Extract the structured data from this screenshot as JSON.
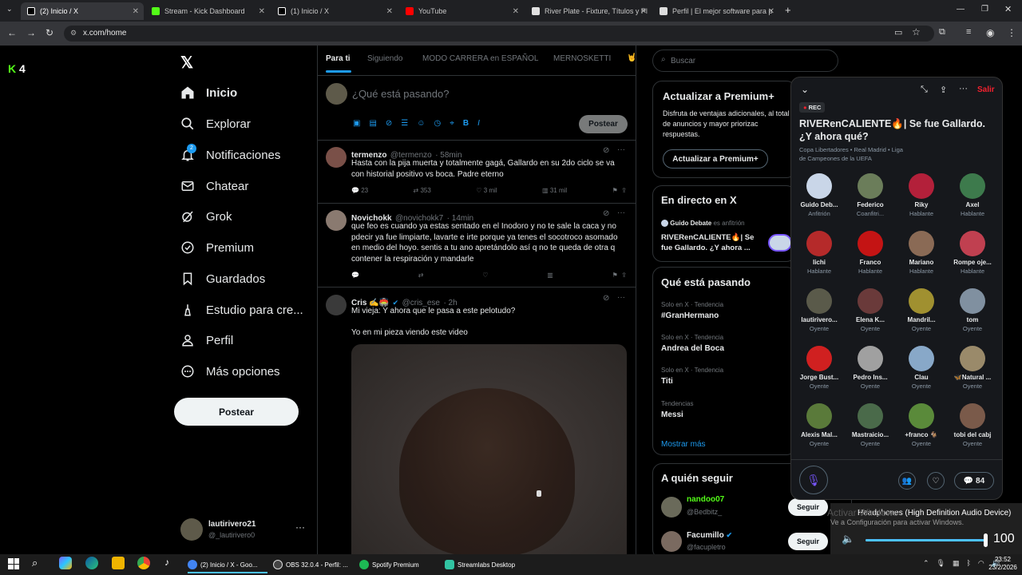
{
  "browser": {
    "tabs": [
      {
        "label": "(2) Inicio / X",
        "active": true
      },
      {
        "label": "Stream - Kick Dashboard"
      },
      {
        "label": "(1) Inicio / X"
      },
      {
        "label": "YouTube"
      },
      {
        "label": "River Plate - Fixture, Títulos y Pl"
      },
      {
        "label": "Perfil | El mejor software para p"
      }
    ],
    "url": "x.com/home"
  },
  "kick": {
    "count": "4"
  },
  "sidebar": {
    "items": [
      {
        "label": "Inicio",
        "icon": "home-icon"
      },
      {
        "label": "Explorar",
        "icon": "search-icon"
      },
      {
        "label": "Notificaciones",
        "icon": "bell-icon",
        "badge": "2"
      },
      {
        "label": "Chatear",
        "icon": "mail-icon"
      },
      {
        "label": "Grok",
        "icon": "grok-icon"
      },
      {
        "label": "Premium",
        "icon": "premium-icon"
      },
      {
        "label": "Guardados",
        "icon": "bookmark-icon"
      },
      {
        "label": "Estudio para cre...",
        "icon": "studio-icon"
      },
      {
        "label": "Perfil",
        "icon": "person-icon"
      },
      {
        "label": "Más opciones",
        "icon": "more-icon"
      }
    ],
    "post_button": "Postear",
    "account": {
      "name": "lautirivero21",
      "handle": "@_lautirivero0"
    }
  },
  "feed": {
    "tabs": [
      "Para ti",
      "Siguiendo",
      "MODO CARRERA en ESPAÑOL",
      "MERNOSKETTI"
    ],
    "composer_placeholder": "¿Qué está pasando?",
    "composer_button": "Postear",
    "tweets": [
      {
        "name": "termenzo",
        "handle": "@termenzo",
        "time": "· 58min",
        "text": "Hasta con la pija muerta y totalmente gagá, Gallardo en su 2do ciclo se va con historial positivo vs boca. Padre eterno",
        "replies": "23",
        "reposts": "353",
        "likes": "3 mil",
        "views": "31 mil"
      },
      {
        "name": "Novichokk",
        "handle": "@novichokk7",
        "time": "· 14min",
        "text": "que feo es cuando ya estas sentado en el Inodoro y no te sale la caca y no pdecir ya fue limpiarte, lavarte e irte porque ya tenes el socotroco asomado en medio del hoyo. sentis a tu ano apretándolo así q no te queda de otra q contener la respiración y mandarle"
      },
      {
        "name": "Cris ✍️🏟️",
        "handle": "@cris_ese",
        "time": "· 2h",
        "text": "Mi vieja: Y ahora que le pasa a este pelotudo?",
        "text2": "Yo en mi pieza viendo este video"
      }
    ]
  },
  "right": {
    "search_placeholder": "Buscar",
    "premium": {
      "title": "Actualizar a Premium+",
      "text": "Disfruta de ventajas adicionales, al total de anuncios y mayor priorizac respuestas.",
      "button": "Actualizar a Premium+"
    },
    "live": {
      "title": "En directo en X",
      "host": "Guido Debate",
      "host_suffix": "es anfitrión",
      "space_title": "RIVERenCALIENTE🔥| Se fue Gallardo. ¿Y ahora ..."
    },
    "trends": {
      "title": "Qué está pasando",
      "items": [
        {
          "cat": "Solo en X · Tendencia",
          "name": "#GranHermano"
        },
        {
          "cat": "Solo en X · Tendencia",
          "name": "Andrea del Boca"
        },
        {
          "cat": "Solo en X · Tendencia",
          "name": "Titi"
        },
        {
          "cat": "Tendencias",
          "name": "Messi"
        }
      ],
      "more": "Mostrar más"
    },
    "follow": {
      "title": "A quién seguir",
      "users": [
        {
          "name": "nandoo07",
          "handle": "@Bedbitz_",
          "button": "Seguir"
        },
        {
          "name": "Facumillo",
          "handle": "@facupletro",
          "button": "Seguir"
        }
      ]
    }
  },
  "space": {
    "rec": "REC",
    "leave": "Salir",
    "title": "RIVERenCALIENTE🔥| Se fue Gallardo. ¿Y ahora qué?",
    "topics": "Copa Libertadores • Real Madrid • Liga de Campeones de la UEFA",
    "users": [
      {
        "name": "Guido Deb...",
        "role": "Anfitrión",
        "color": "#c9d6e8"
      },
      {
        "name": "Federico",
        "role": "Coanfitri...",
        "color": "#6b7d5a"
      },
      {
        "name": "Riky",
        "role": "Hablante",
        "color": "#b3203a"
      },
      {
        "name": "Axel",
        "role": "Hablante",
        "color": "#3d7a4c"
      },
      {
        "name": "lichi",
        "role": "Hablante",
        "color": "#b52a2a"
      },
      {
        "name": "Franco",
        "role": "Hablante",
        "color": "#c41414"
      },
      {
        "name": "Mariano",
        "role": "Hablante",
        "color": "#8a6a55"
      },
      {
        "name": "Rompe oje...",
        "role": "Hablante",
        "color": "#c04050"
      },
      {
        "name": "lautirivero...",
        "role": "Oyente",
        "color": "#5a5a4a"
      },
      {
        "name": "Elena K...",
        "role": "Oyente",
        "color": "#6a3a3a"
      },
      {
        "name": "Mandril...",
        "role": "Oyente",
        "color": "#a09030"
      },
      {
        "name": "tom",
        "role": "Oyente",
        "color": "#8090a0"
      },
      {
        "name": "Jorge Bust...",
        "role": "Oyente",
        "color": "#d02020"
      },
      {
        "name": "Pedro Ins...",
        "role": "Oyente",
        "color": "#a0a0a0"
      },
      {
        "name": "Clau",
        "role": "Oyente",
        "color": "#88a8c8"
      },
      {
        "name": "🦋Natural ...",
        "role": "Oyente",
        "color": "#9a8a6a"
      },
      {
        "name": "Alexis Mal...",
        "role": "Oyente",
        "color": "#5a7a3a"
      },
      {
        "name": "Mastraicio...",
        "role": "Oyente",
        "color": "#4a6a4a"
      },
      {
        "name": "+franco 🐐",
        "role": "Oyente",
        "color": "#5a8a3a"
      },
      {
        "name": "tobi del cabj",
        "role": "Oyente",
        "color": "#7a5a4a"
      }
    ],
    "comments": "84"
  },
  "volume": {
    "device": "Headphones (High Definition Audio Device)",
    "activate": "Ve a Configuración para activar Windows.",
    "level": "100",
    "activate_title": "Activar Windows"
  },
  "taskbar": {
    "apps": [
      {
        "label": "(2) Inicio / X - Goo...",
        "color": "#4285f4"
      },
      {
        "label": "OBS 32.0.4 - Perfil: ...",
        "color": "#444"
      },
      {
        "label": "Spotify Premium",
        "color": "#1db954"
      },
      {
        "label": "Streamlabs Desktop",
        "color": "#31c3a2"
      }
    ],
    "time": "23:52",
    "date": "23/2/2026"
  }
}
